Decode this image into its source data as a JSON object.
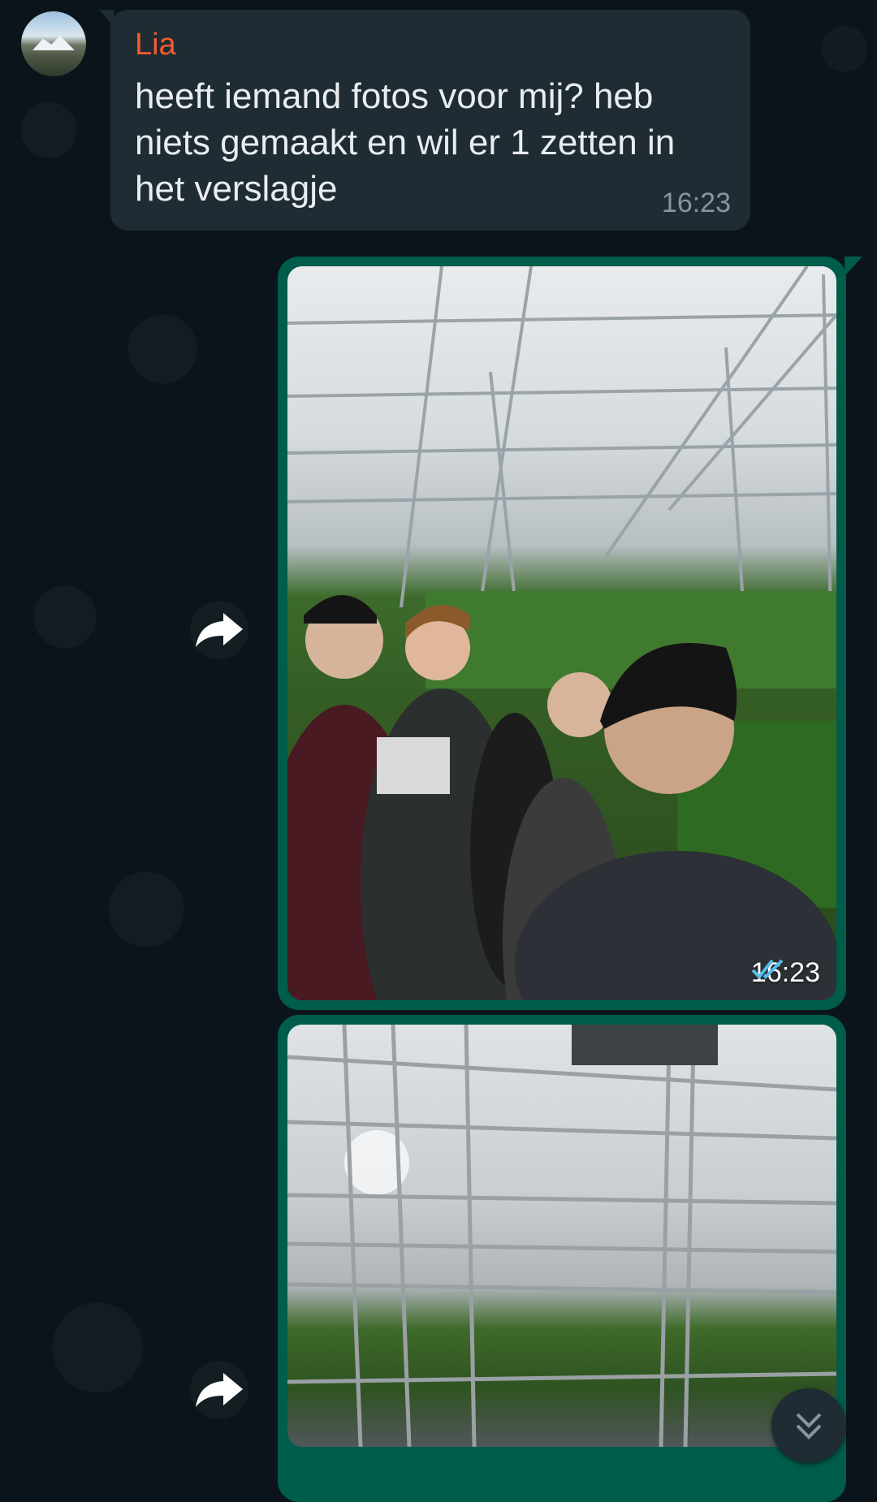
{
  "incoming_message": {
    "sender": "Lia",
    "text": "heeft iemand fotos voor mij? heb niets gemaakt en wil er 1 zetten in het verslagje",
    "time": "16:23"
  },
  "outgoing_photos": [
    {
      "time": "16:23",
      "status": "read",
      "status_icon": "double-check-icon",
      "status_color": "#53bdeb"
    },
    {
      "time": "",
      "status": ""
    }
  ],
  "icons": {
    "forward": "forward-arrow-icon",
    "scroll_down": "double-chevron-down-icon"
  },
  "colors": {
    "background": "#0b141a",
    "incoming_bubble": "#1f2c34",
    "outgoing_bubble": "#005c4b",
    "sender_name": "#f15c2e",
    "read_ticks": "#53bdeb"
  }
}
